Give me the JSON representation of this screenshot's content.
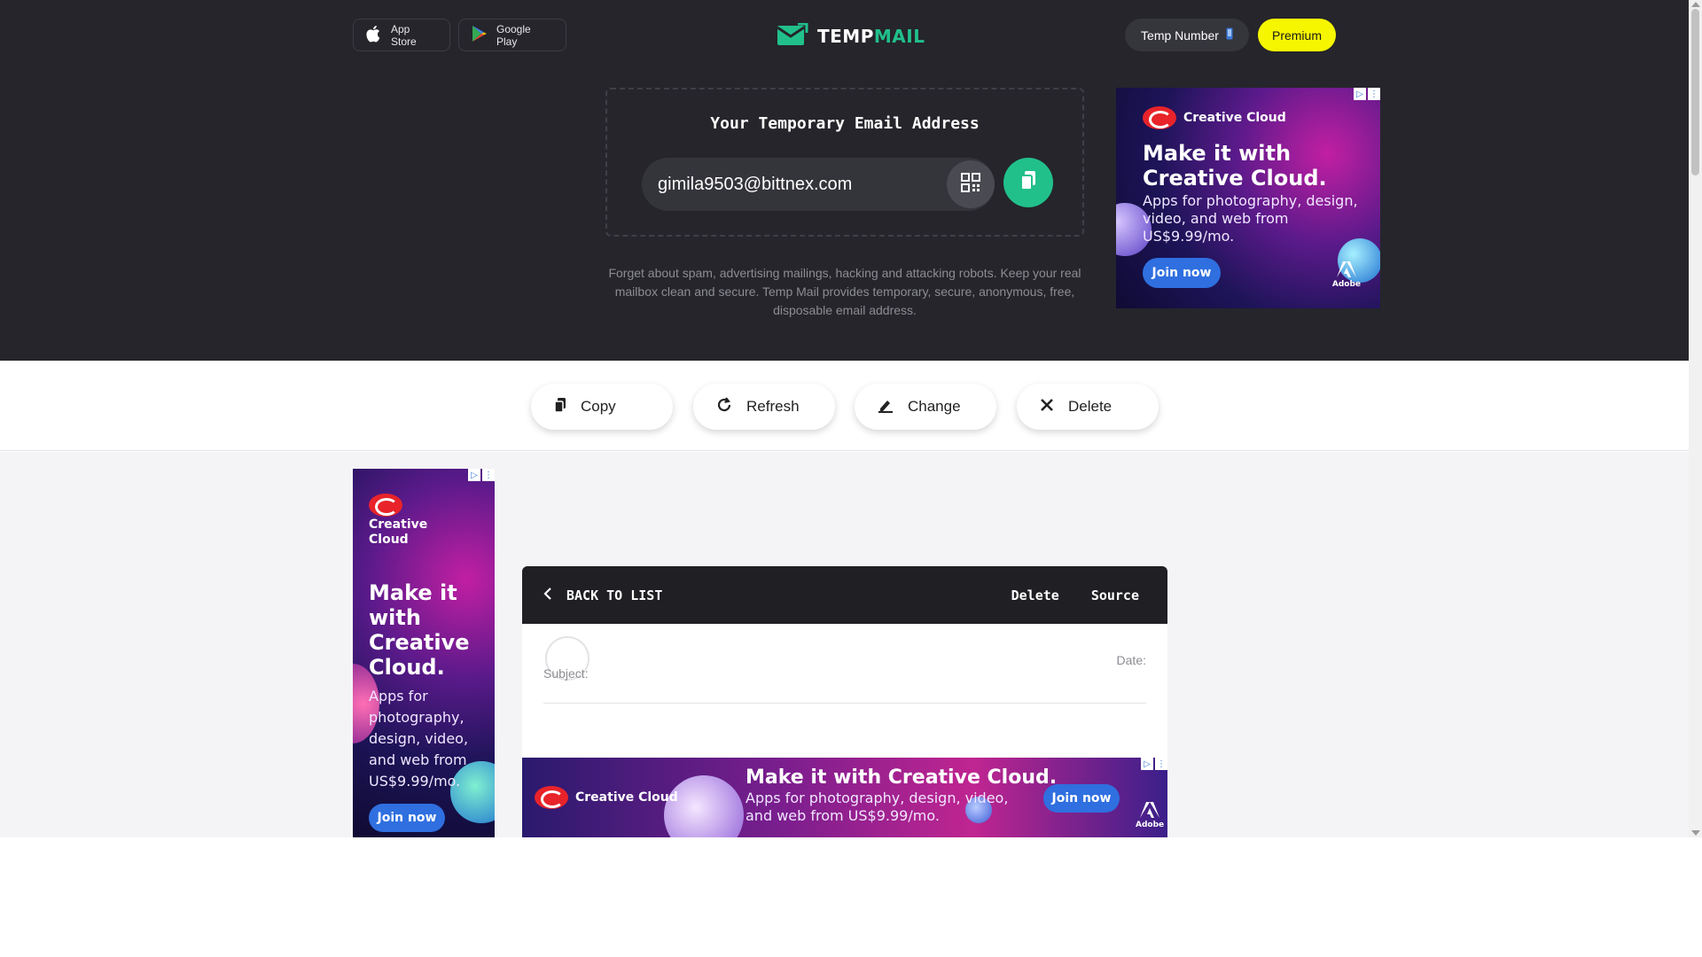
{
  "header": {
    "app_store_label": "App Store",
    "google_play_label": "Google Play",
    "logo_part1": "TEMP",
    "logo_part2": "MAIL",
    "temp_number_label": "Temp Number",
    "premium_label": "Premium"
  },
  "email": {
    "title": "Your Temporary Email Address",
    "address": "gimila9503@bittnex.com",
    "description": "Forget about spam, advertising mailings, hacking and attacking robots. Keep your real mailbox clean and secure. Temp Mail provides temporary, secure, anonymous, free, disposable email address."
  },
  "actions": {
    "copy": "Copy",
    "refresh": "Refresh",
    "change": "Change",
    "delete": "Delete"
  },
  "message": {
    "back_label": "BACK TO LIST",
    "delete_label": "Delete",
    "source_label": "Source",
    "date_label": "Date:",
    "subject_label": "Subject:"
  },
  "ads": {
    "brand": "Creative Cloud",
    "brand_line1": "Creative",
    "brand_line2": "Cloud",
    "headline": "Make it with Creative Cloud.",
    "body": "Apps for photography, design, video, and web from US$9.99/mo.",
    "cta": "Join now",
    "adobe": "Adobe"
  },
  "colors": {
    "header_bg": "#25252b",
    "accent_green": "#21c08b",
    "premium_yellow": "#f6f600",
    "panel_header": "#1f1f24"
  }
}
